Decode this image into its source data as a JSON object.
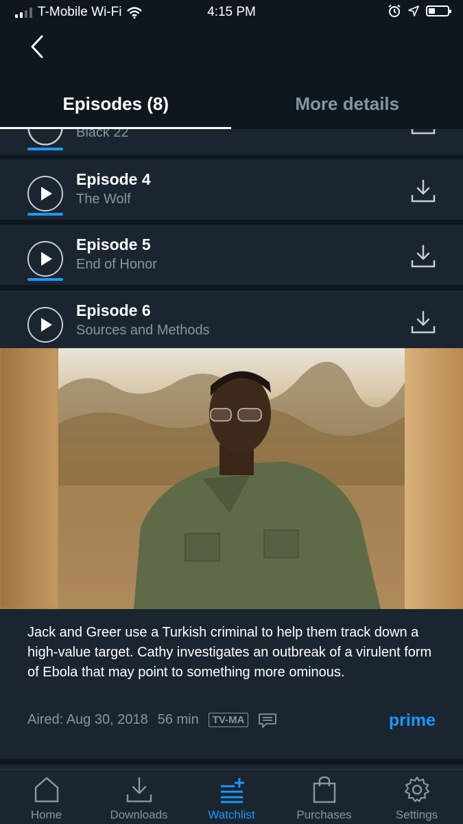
{
  "status_bar": {
    "carrier": "T-Mobile Wi-Fi",
    "time": "4:15 PM"
  },
  "tabs": [
    {
      "label": "Episodes (8)",
      "active": true
    },
    {
      "label": "More details",
      "active": false
    }
  ],
  "episodes": [
    {
      "title": "",
      "subtitle": "Black 22",
      "progress": 1.0
    },
    {
      "title": "Episode 4",
      "subtitle": "The Wolf",
      "progress": 1.0
    },
    {
      "title": "Episode 5",
      "subtitle": "End of Honor",
      "progress": 1.0
    },
    {
      "title": "Episode 6",
      "subtitle": "Sources and Methods",
      "progress": 0
    }
  ],
  "details": {
    "synopsis": "Jack and Greer use a Turkish criminal to help them track down a high-value target. Cathy investigates an outbreak of a virulent form of Ebola that may point to something more ominous.",
    "aired": "Aired: Aug 30, 2018",
    "duration": "56 min",
    "rating": "TV-MA",
    "badge": "prime"
  },
  "bottom_nav": [
    {
      "label": "Home",
      "icon": "home-icon",
      "active": false
    },
    {
      "label": "Downloads",
      "icon": "download-icon",
      "active": false
    },
    {
      "label": "Watchlist",
      "icon": "watchlist-icon",
      "active": true
    },
    {
      "label": "Purchases",
      "icon": "shopping-bag-icon",
      "active": false
    },
    {
      "label": "Settings",
      "icon": "gear-icon",
      "active": false
    }
  ],
  "colors": {
    "background": "#0f171e",
    "card": "#1b2530",
    "accent": "#1a98ff",
    "muted": "#8197a4"
  }
}
